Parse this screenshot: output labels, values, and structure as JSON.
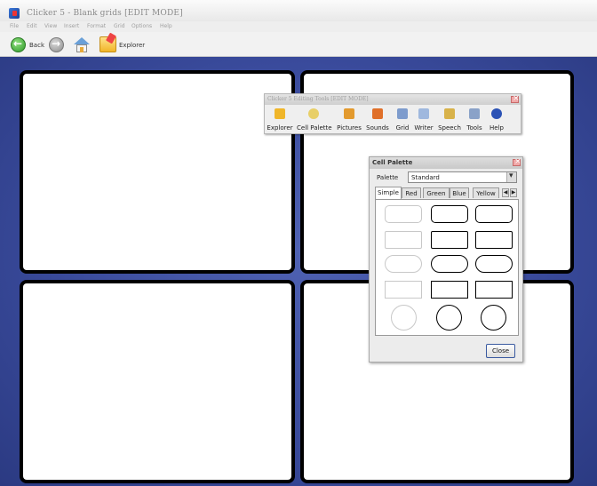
{
  "window": {
    "title": "Clicker 5 - Blank grids [EDIT MODE]"
  },
  "menu": [
    "File",
    "Edit",
    "View",
    "Insert",
    "Format",
    "Grid",
    "Options",
    "Help"
  ],
  "toolbar": {
    "back_label": "Back",
    "explorer_label": "Explorer"
  },
  "editing_tools": {
    "title": "Clicker 5 Editing Tools [EDIT MODE]",
    "tools": [
      {
        "label": "Explorer",
        "icon": "explorer-icon",
        "color": "#f0b62a"
      },
      {
        "label": "Cell Palette",
        "icon": "cell-palette-icon",
        "color": "#e8cf68"
      },
      {
        "label": "Pictures",
        "icon": "pictures-icon",
        "color": "#e39a2e"
      },
      {
        "label": "Sounds",
        "icon": "sounds-icon",
        "color": "#e0702a"
      },
      {
        "label": "Grid",
        "icon": "grid-icon",
        "color": "#7e9ccd"
      },
      {
        "label": "Writer",
        "icon": "writer-icon",
        "color": "#9fb8de"
      },
      {
        "label": "Speech",
        "icon": "speech-icon",
        "color": "#d8b24a"
      },
      {
        "label": "Tools",
        "icon": "tools-icon",
        "color": "#8aa2c8"
      },
      {
        "label": "Help",
        "icon": "help-icon",
        "color": "#2b52b5"
      }
    ]
  },
  "cell_palette": {
    "title": "Cell Palette",
    "palette_label": "Palette",
    "palette_value": "Standard",
    "tabs": [
      "Simple",
      "Red",
      "Green",
      "Blue",
      "Yellow"
    ],
    "active_tab": "Simple",
    "close_label": "Close"
  },
  "colors": {
    "workspace": "#3a4b9c",
    "cell_border": "#000000"
  }
}
